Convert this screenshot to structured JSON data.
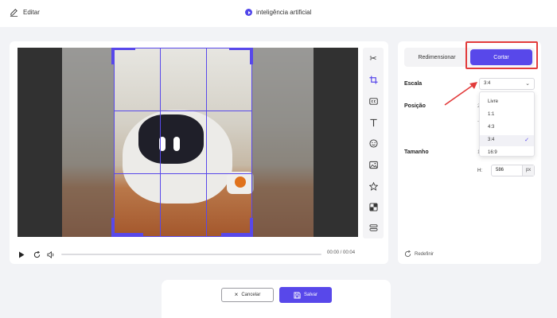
{
  "header": {
    "edit_label": "Editar",
    "title": "inteligência artificial"
  },
  "player": {
    "time": "00:00 / 00:04",
    "progress": 0
  },
  "toolbar": {
    "icons": [
      "scissors-icon",
      "crop-icon",
      "caption-icon",
      "text-icon",
      "emoji-icon",
      "image-icon",
      "star-icon",
      "mosaic-icon",
      "adjust-icon"
    ]
  },
  "panel": {
    "tabs": {
      "resize": "Redimensionar",
      "crop": "Cortar"
    },
    "scale_label": "Escala",
    "position_label": "Posição",
    "size_label": "Tamanho",
    "scale_selected": "3:4",
    "scale_options": [
      "Livre",
      "1:1",
      "4:3",
      "3:4",
      "16:9"
    ],
    "peek": {
      "pos1": "2",
      "pos2": "-",
      "size1": "1"
    },
    "height_label": "H:",
    "height_value": "586",
    "height_unit": "px",
    "reset_label": "Redefinir"
  },
  "footer": {
    "cancel_label": "Cancelar",
    "save_label": "Salvar"
  },
  "colors": {
    "accent": "#5848ea",
    "highlight": "#e23b3b"
  }
}
